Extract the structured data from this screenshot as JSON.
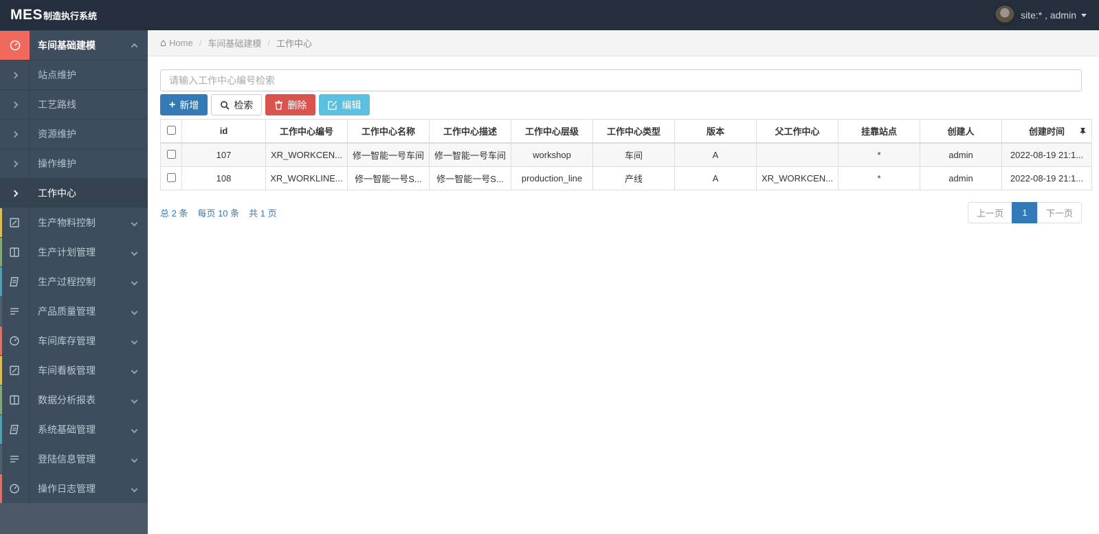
{
  "topbar": {
    "brand": "MES",
    "brand_suffix": "制造执行系统",
    "user": "site:* , admin"
  },
  "breadcrumb": {
    "home": "Home",
    "level1": "车间基础建模",
    "level2": "工作中心"
  },
  "sidebar": {
    "items": [
      {
        "label": "车间基础建模",
        "icon": "gauge-icon",
        "accent": "#f0695c",
        "expanded": true,
        "children": [
          {
            "label": "站点维护"
          },
          {
            "label": "工艺路线"
          },
          {
            "label": "资源维护"
          },
          {
            "label": "操作维护"
          },
          {
            "label": "工作中心",
            "active": true
          }
        ]
      },
      {
        "label": "生产物料控制",
        "icon": "pencil-icon",
        "accent": "#ddbe56"
      },
      {
        "label": "生产计划管理",
        "icon": "columns-icon",
        "accent": "#83a87d"
      },
      {
        "label": "生产过程控制",
        "icon": "book-icon",
        "accent": "#549fae"
      },
      {
        "label": "产品质量管理",
        "icon": "list-icon",
        "accent": "#515f6d"
      },
      {
        "label": "车间库存管理",
        "icon": "gauge-icon",
        "accent": "#d8736c"
      },
      {
        "label": "车间看板管理",
        "icon": "pencil-icon",
        "accent": "#ddbe56"
      },
      {
        "label": "数据分析报表",
        "icon": "columns-icon",
        "accent": "#83a87d"
      },
      {
        "label": "系统基础管理",
        "icon": "book-icon",
        "accent": "#549fae"
      },
      {
        "label": "登陆信息管理",
        "icon": "list-icon",
        "accent": "#515f6d"
      },
      {
        "label": "操作日志管理",
        "icon": "gauge-icon",
        "accent": "#d8736c"
      }
    ]
  },
  "search": {
    "placeholder": "请输入工作中心编号检索",
    "value": ""
  },
  "toolbar": {
    "add": "新增",
    "query": "检索",
    "delete": "删除",
    "edit": "编辑",
    "add_color": "#337ab7",
    "query_color": "#ffffff",
    "delete_color": "#d9534f",
    "edit_color": "#5bc0de"
  },
  "table": {
    "columns": [
      "id",
      "工作中心编号",
      "工作中心名称",
      "工作中心描述",
      "工作中心层级",
      "工作中心类型",
      "版本",
      "父工作中心",
      "挂靠站点",
      "创建人",
      "创建时间"
    ],
    "rows": [
      [
        "107",
        "XR_WORKCEN...",
        "修一智能一号车间",
        "修一智能一号车间",
        "workshop",
        "车间",
        "A",
        "",
        "*",
        "admin",
        "2022-08-19 21:1..."
      ],
      [
        "108",
        "XR_WORKLINE...",
        "修一智能一号S...",
        "修一智能一号S...",
        "production_line",
        "产线",
        "A",
        "XR_WORKCEN...",
        "*",
        "admin",
        "2022-08-19 21:1..."
      ]
    ]
  },
  "pagination": {
    "summary_total": "总 2 条",
    "summary_per_page": "每页 10 条",
    "summary_pages": "共 1 页",
    "summary_color": "#337ab7",
    "prev": "上一页",
    "page": "1",
    "next": "下一页",
    "active_color": "#337ab7"
  }
}
